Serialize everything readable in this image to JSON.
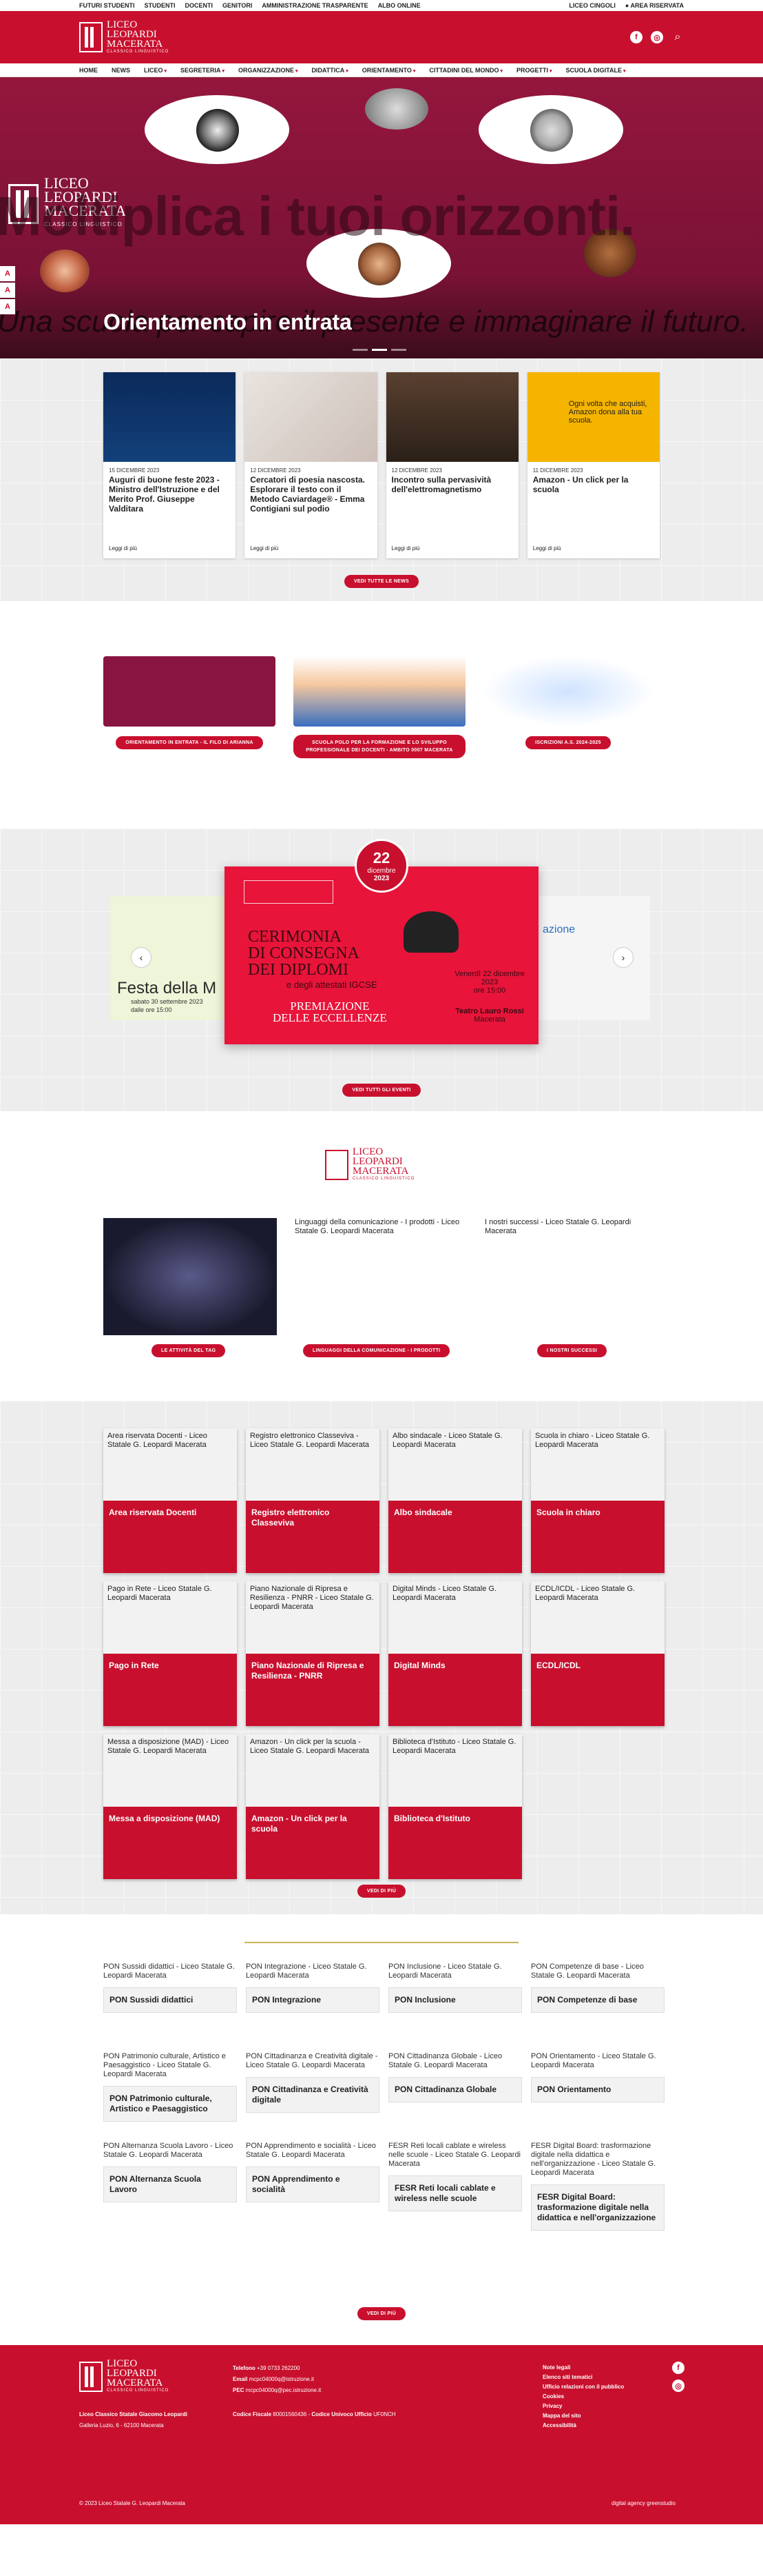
{
  "topbar": {
    "links": [
      "FUTURI STUDENTI",
      "STUDENTI",
      "DOCENTI",
      "GENITORI",
      "AMMINISTRAZIONE TRASPARENTE",
      "ALBO ONLINE"
    ],
    "right": [
      "LICEO CINGOLI",
      "AREA RISERVATA"
    ]
  },
  "brand": {
    "line1": "LICEO",
    "line2": "LEOPARDI",
    "line3": "MACERATA",
    "sub": "CLASSICO LINGUISTICO"
  },
  "nav": [
    "HOME",
    "NEWS",
    "LICEO",
    "SEGRETERIA",
    "ORGANIZZAZIONE",
    "DIDATTICA",
    "ORIENTAMENTO",
    "CITTADINI DEL MONDO",
    "PROGETTI",
    "SCUOLA DIGITALE"
  ],
  "hero": {
    "headline": "Moltiplica i tuoi orizzonti.",
    "tagline": "Una scuola per capire il presente e immaginare il futuro.",
    "caption": "Orientamento in entrata",
    "access": [
      "A",
      "A",
      "A"
    ]
  },
  "news": {
    "items": [
      {
        "date": "15 DICEMBRE 2023",
        "title": "Auguri di buone feste 2023 - Ministro dell'Istruzione e del Merito Prof. Giuseppe Valditara",
        "more": "Leggi di più"
      },
      {
        "date": "12 DICEMBRE 2023",
        "title": "Cercatori di poesia nascosta. Esplorare il testo con il Metodo Caviardage® - Emma Contigiani sul podio",
        "more": "Leggi di più"
      },
      {
        "date": "12 DICEMBRE 2023",
        "title": "Incontro sulla pervasività dell'elettromagnetismo",
        "more": "Leggi di più"
      },
      {
        "date": "11 DICEMBRE 2023",
        "title": "Amazon - Un click per la scuola",
        "more": "Leggi di più"
      }
    ],
    "card4_image_text": "Ogni volta che acquisti, Amazon dona alla tua scuola.",
    "button": "VEDI TUTTE LE NEWS"
  },
  "promos": [
    {
      "button": "ORIENTAMENTO IN ENTRATA - IL FILO DI ARIANNA"
    },
    {
      "button": "SCUOLA POLO PER LA FORMAZIONE E LO SVILUPPO PROFESSIONALE DEI DOCENTI - AMBITO 0007 MACERATA"
    },
    {
      "button": "ISCRIZIONI A.S. 2024-2025"
    }
  ],
  "events": {
    "badge_day": "22",
    "badge_month": "dicembre",
    "badge_year": "2023",
    "title1": "CERIMONIA",
    "title2": "DI CONSEGNA",
    "title3": "DEI DIPLOMI",
    "subtitle": "e degli attestati IGCSE",
    "prem1": "PREMIAZIONE",
    "prem2": "DELLE ECCELLENZE",
    "when": "Venerdì 22 dicembre 2023",
    "time": "ore 15:00",
    "where": "Teatro Lauro Rossi",
    "city": "Macerata",
    "side_text1": "Festa della M",
    "side_text2": "sabato 30 settembre 2023",
    "side_text3": "dalle ore 15:00",
    "side_right": "azione",
    "button": "VEDI TUTTI GLI EVENTI"
  },
  "videos": {
    "items": [
      {
        "title": "",
        "button": "LE ATTIVITÀ DEL TAG"
      },
      {
        "title": "Linguaggi della comunicazione - I prodotti - Liceo Statale G. Leopardi Macerata",
        "button": "LINGUAGGI DELLA COMUNICAZIONE - I PRODOTTI"
      },
      {
        "title": "I nostri successi - Liceo Statale G. Leopardi Macerata",
        "button": "I NOSTRI SUCCESSI"
      }
    ]
  },
  "tiles": {
    "items": [
      {
        "top": "Area riservata Docenti - Liceo Statale G. Leopardi Macerata",
        "label": "Area riservata Docenti"
      },
      {
        "top": "Registro elettronico Classeviva - Liceo Statale G. Leopardi Macerata",
        "label": "Registro elettronico Classeviva"
      },
      {
        "top": "Albo sindacale - Liceo Statale G. Leopardi Macerata",
        "label": "Albo sindacale"
      },
      {
        "top": "Scuola in chiaro - Liceo Statale G. Leopardi Macerata",
        "label": "Scuola in chiaro"
      },
      {
        "top": "Pago in Rete - Liceo Statale G. Leopardi Macerata",
        "label": "Pago in Rete"
      },
      {
        "top": "Piano Nazionale di Ripresa e Resilienza - PNRR - Liceo Statale G. Leopardi Macerata",
        "label": "Piano Nazionale di Ripresa e Resilienza - PNRR"
      },
      {
        "top": "Digital Minds - Liceo Statale G. Leopardi Macerata",
        "label": "Digital Minds"
      },
      {
        "top": "ECDL/ICDL - Liceo Statale G. Leopardi Macerata",
        "label": "ECDL/ICDL"
      },
      {
        "top": "Messa a disposizione (MAD) - Liceo Statale G. Leopardi Macerata",
        "label": "Messa a disposizione (MAD)"
      },
      {
        "top": "Amazon - Un click per la scuola - Liceo Statale G. Leopardi Macerata",
        "label": "Amazon - Un click per la scuola"
      },
      {
        "top": "Biblioteca d'Istituto - Liceo Statale G. Leopardi Macerata",
        "label": "Biblioteca d'Istituto"
      }
    ],
    "button": "VEDI DI PIÙ"
  },
  "pon": {
    "items": [
      {
        "top": "PON Sussidi didattici - Liceo Statale G. Leopardi Macerata",
        "label": "PON Sussidi didattici"
      },
      {
        "top": "PON Integrazione - Liceo Statale G. Leopardi Macerata",
        "label": "PON Integrazione"
      },
      {
        "top": "PON Inclusione - Liceo Statale G. Leopardi Macerata",
        "label": "PON Inclusione"
      },
      {
        "top": "PON Competenze di base - Liceo Statale G. Leopardi Macerata",
        "label": "PON Competenze di base"
      },
      {
        "top": "PON Patrimonio culturale, Artistico e Paesaggistico - Liceo Statale G. Leopardi Macerata",
        "label": "PON Patrimonio culturale, Artistico e Paesaggistico"
      },
      {
        "top": "PON Cittadinanza e Creatività digitale - Liceo Statale G. Leopardi Macerata",
        "label": "PON Cittadinanza e Creatività digitale"
      },
      {
        "top": "PON Cittadinanza Globale - Liceo Statale G. Leopardi Macerata",
        "label": "PON Cittadinanza Globale"
      },
      {
        "top": "PON Orientamento - Liceo Statale G. Leopardi Macerata",
        "label": "PON Orientamento"
      },
      {
        "top": "PON Alternanza Scuola Lavoro - Liceo Statale G. Leopardi Macerata",
        "label": "PON Alternanza Scuola Lavoro"
      },
      {
        "top": "PON Apprendimento e socialità - Liceo Statale G. Leopardi Macerata",
        "label": "PON Apprendimento e socialità"
      },
      {
        "top": "FESR Reti locali cablate e wireless nelle scuole - Liceo Statale G. Leopardi Macerata",
        "label": "FESR Reti locali cablate e wireless nelle scuole"
      },
      {
        "top": "FESR Digital Board: trasformazione digitale nella didattica e nell'organizzazione - Liceo Statale G. Leopardi Macerata",
        "label": "FESR Digital Board: trasformazione digitale nella didattica e nell'organizzazione"
      }
    ],
    "button": "VEDI DI PIÙ"
  },
  "footer": {
    "school": "Liceo Classico Statale Giacomo Leopardi",
    "address": "Galleria Luzio, 6 - 62100 Macerata",
    "phone_label": "Telefono",
    "phone": "+39 0733 262200",
    "email_label": "Email",
    "email": "mcpc04000q@istruzione.it",
    "pec_label": "PEC",
    "pec": "mcpc04000q@pec.istruzione.it",
    "cf_label": "Codice Fiscale",
    "cf": "80001560436",
    "cu_label": "Codice Univoco Ufficio",
    "cu": "UF0NCH",
    "links": [
      "Note legali",
      "Elenco siti tematici",
      "Ufficio relazioni con il pubblico",
      "Cookies",
      "Privacy",
      "Mappa del sito",
      "Accessibilità"
    ],
    "copyright": "© 2023 Liceo Statale G. Leopardi Macerata",
    "credit": "digital agency greenstudio"
  },
  "colors": {
    "brand": "#c8102e",
    "hero": "#8a1440"
  }
}
